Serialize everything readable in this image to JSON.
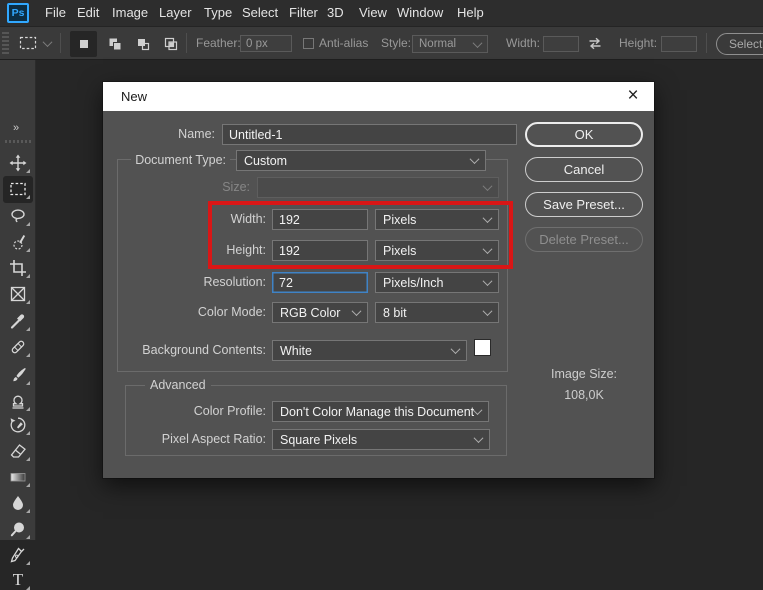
{
  "menu_bar": {
    "logo": "Ps",
    "items": [
      "File",
      "Edit",
      "Image",
      "Layer",
      "Type",
      "Select",
      "Filter",
      "3D",
      "View",
      "Window",
      "Help"
    ]
  },
  "options_bar": {
    "feather": {
      "label": "Feather:",
      "value": "0 px"
    },
    "anti_alias_label": "Anti-alias",
    "style": {
      "label": "Style:",
      "value": "Normal"
    },
    "width": {
      "label": "Width:",
      "value": ""
    },
    "height": {
      "label": "Height:",
      "value": ""
    },
    "select_and_mask_label": "Select and Mask..."
  },
  "toolbar": {
    "collapse_glyph": "»",
    "type_tool_glyph": "T",
    "selected_tool": "rectangular-marquee",
    "tools": [
      "move",
      "rectangular-marquee",
      "lasso",
      "quick-selection",
      "crop",
      "frame",
      "eyedropper",
      "spot-healing-brush",
      "brush",
      "clone-stamp",
      "history-brush",
      "eraser",
      "gradient",
      "blur",
      "dodge",
      "pen",
      "type"
    ]
  },
  "dialog": {
    "title": "New",
    "close_glyph": "×",
    "name": {
      "label": "Name:",
      "value": "Untitled-1"
    },
    "document_type": {
      "label": "Document Type:",
      "value": "Custom"
    },
    "size": {
      "label": "Size:",
      "value": ""
    },
    "width": {
      "label": "Width:",
      "value": "192",
      "unit": "Pixels"
    },
    "height": {
      "label": "Height:",
      "value": "192",
      "unit": "Pixels"
    },
    "resolution": {
      "label": "Resolution:",
      "value": "72",
      "unit": "Pixels/Inch"
    },
    "color_mode": {
      "label": "Color Mode:",
      "value": "RGB Color",
      "bit_depth": "8 bit"
    },
    "background_contents": {
      "label": "Background Contents:",
      "value": "White",
      "swatch_color": "#ffffff"
    },
    "advanced": {
      "legend": "Advanced",
      "color_profile": {
        "label": "Color Profile:",
        "value": "Don't Color Manage this Document"
      },
      "pixel_aspect_ratio": {
        "label": "Pixel Aspect Ratio:",
        "value": "Square Pixels"
      }
    },
    "buttons": {
      "ok": "OK",
      "cancel": "Cancel",
      "save_preset": "Save Preset...",
      "delete_preset": "Delete Preset..."
    },
    "image_size": {
      "label": "Image Size:",
      "value": "108,0K"
    }
  },
  "annotation": {
    "color": "#d91616"
  }
}
